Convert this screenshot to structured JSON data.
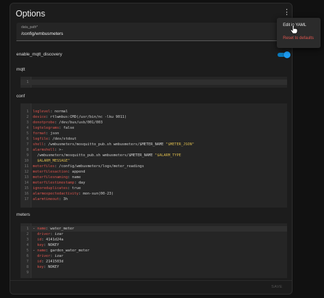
{
  "card": {
    "title": "Options",
    "data_path": {
      "label": "data_path*",
      "value": "/config/wmbusmeters"
    },
    "mqtt_discovery": {
      "label": "enable_mqtt_discovery",
      "enabled": true
    },
    "mqtt": {
      "label": "mqtt",
      "lines": [
        {
          "n": "1",
          "tokens": [
            {
              "t": "",
              "c": "p"
            }
          ]
        }
      ]
    },
    "conf": {
      "label": "conf",
      "lines": [
        {
          "n": "1",
          "tokens": [
            {
              "t": "loglevel",
              "c": "k"
            },
            {
              "t": ": normal",
              "c": "p"
            }
          ]
        },
        {
          "n": "2",
          "tokens": [
            {
              "t": "device",
              "c": "k"
            },
            {
              "t": ": rtlwmbus:CMD(/usr/bin/nc -lku 9011)",
              "c": "p"
            }
          ]
        },
        {
          "n": "3",
          "tokens": [
            {
              "t": "donotprobe",
              "c": "k"
            },
            {
              "t": ": /dev/bus/usb/001/003",
              "c": "p"
            }
          ]
        },
        {
          "n": "4",
          "tokens": [
            {
              "t": "logtelegrams",
              "c": "k"
            },
            {
              "t": ": false",
              "c": "p"
            }
          ]
        },
        {
          "n": "5",
          "tokens": [
            {
              "t": "format",
              "c": "k"
            },
            {
              "t": ": json",
              "c": "p"
            }
          ]
        },
        {
          "n": "6",
          "tokens": [
            {
              "t": "logfile",
              "c": "k"
            },
            {
              "t": ": /dev/stdout",
              "c": "p"
            }
          ]
        },
        {
          "n": "7",
          "tokens": [
            {
              "t": "shell",
              "c": "k"
            },
            {
              "t": ": /wmbusmeters/mosquitto_pub.sh wmbusmeters/$METER_NAME ",
              "c": "p"
            },
            {
              "t": "\"$METER_JSON\"",
              "c": "s"
            }
          ]
        },
        {
          "n": "8",
          "tokens": [
            {
              "t": "alarmshell",
              "c": "k"
            },
            {
              "t": ": >-",
              "c": "p"
            }
          ]
        },
        {
          "n": "9",
          "tokens": [
            {
              "t": "  /wmbusmeters/mosquitto_pub.sh wmbusmeters/$METER_NAME ",
              "c": "p"
            },
            {
              "t": "\"$ALARM_TYPE",
              "c": "s"
            }
          ]
        },
        {
          "n": "10",
          "tokens": [
            {
              "t": "  $ALARM_MESSAGE\"",
              "c": "s"
            }
          ]
        },
        {
          "n": "11",
          "tokens": [
            {
              "t": "meterfiles",
              "c": "k"
            },
            {
              "t": ": /config/wmbusmeters/logs/meter_readings",
              "c": "p"
            }
          ]
        },
        {
          "n": "12",
          "tokens": [
            {
              "t": "meterfilesaction",
              "c": "k"
            },
            {
              "t": ": append",
              "c": "p"
            }
          ]
        },
        {
          "n": "13",
          "tokens": [
            {
              "t": "meterfilesnaming",
              "c": "k"
            },
            {
              "t": ": name",
              "c": "p"
            }
          ]
        },
        {
          "n": "14",
          "tokens": [
            {
              "t": "meterfilestimestamp",
              "c": "k"
            },
            {
              "t": ": day",
              "c": "p"
            }
          ]
        },
        {
          "n": "15",
          "tokens": [
            {
              "t": "ignoreduplicates",
              "c": "k"
            },
            {
              "t": ": true",
              "c": "p"
            }
          ]
        },
        {
          "n": "16",
          "tokens": [
            {
              "t": "alarmexpectedactivity",
              "c": "k"
            },
            {
              "t": ": mon-sun(00-23)",
              "c": "p"
            }
          ]
        },
        {
          "n": "17",
          "tokens": [
            {
              "t": "alarmtimeout",
              "c": "k"
            },
            {
              "t": ": 3h",
              "c": "p"
            }
          ]
        }
      ]
    },
    "meters": {
      "label": "meters",
      "lines": [
        {
          "n": "1",
          "tokens": [
            {
              "t": "- ",
              "c": "p"
            },
            {
              "t": "name",
              "c": "k"
            },
            {
              "t": ": water_meter",
              "c": "p"
            }
          ]
        },
        {
          "n": "2",
          "tokens": [
            {
              "t": "  ",
              "c": "p"
            },
            {
              "t": "driver",
              "c": "k"
            },
            {
              "t": ": izar",
              "c": "p"
            }
          ]
        },
        {
          "n": "3",
          "tokens": [
            {
              "t": "  ",
              "c": "p"
            },
            {
              "t": "id",
              "c": "k"
            },
            {
              "t": ": 4141d24a",
              "c": "p"
            }
          ]
        },
        {
          "n": "4",
          "tokens": [
            {
              "t": "  ",
              "c": "p"
            },
            {
              "t": "key",
              "c": "k"
            },
            {
              "t": ": NOKEY",
              "c": "p"
            }
          ]
        },
        {
          "n": "5",
          "tokens": [
            {
              "t": "- ",
              "c": "p"
            },
            {
              "t": "name",
              "c": "k"
            },
            {
              "t": ": garden_water_meter",
              "c": "p"
            }
          ]
        },
        {
          "n": "6",
          "tokens": [
            {
              "t": "  ",
              "c": "p"
            },
            {
              "t": "driver",
              "c": "k"
            },
            {
              "t": ": izar",
              "c": "p"
            }
          ]
        },
        {
          "n": "7",
          "tokens": [
            {
              "t": "  ",
              "c": "p"
            },
            {
              "t": "id",
              "c": "k"
            },
            {
              "t": ": 2141503d",
              "c": "p"
            }
          ]
        },
        {
          "n": "8",
          "tokens": [
            {
              "t": "  ",
              "c": "p"
            },
            {
              "t": "key",
              "c": "k"
            },
            {
              "t": ": NOKEY",
              "c": "p"
            }
          ]
        },
        {
          "n": "9",
          "tokens": [
            {
              "t": "",
              "c": "p"
            }
          ]
        }
      ]
    },
    "save_label": "SAVE"
  },
  "menu": {
    "edit_yaml": "Edit in YAML",
    "reset": "Reset to defaults"
  },
  "icons": {
    "kebab": "more-vertical-icon",
    "cursor": "hand-pointer-icon"
  },
  "colors": {
    "accent": "#1d9bf0",
    "key": "#e0564f",
    "string": "#d8b94d",
    "danger": "#e0564f"
  }
}
